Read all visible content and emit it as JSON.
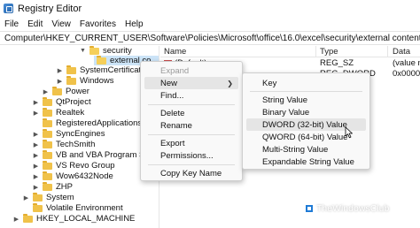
{
  "window": {
    "title": "Registry Editor"
  },
  "menubar": {
    "items": [
      "File",
      "Edit",
      "View",
      "Favorites",
      "Help"
    ]
  },
  "address": {
    "path": "Computer\\HKEY_CURRENT_USER\\Software\\Policies\\Microsoft\\office\\16.0\\excel\\security\\external content"
  },
  "tree": {
    "items": [
      {
        "label": "security",
        "chevron": "down",
        "selected": false
      },
      {
        "label": "external co...",
        "chevron": "",
        "selected": true
      },
      {
        "label": "SystemCertificates",
        "chevron": "right",
        "selected": false
      },
      {
        "label": "Windows",
        "chevron": "right",
        "selected": false
      },
      {
        "label": "Power",
        "chevron": "right",
        "selected": false
      },
      {
        "label": "QtProject",
        "chevron": "right",
        "selected": false
      },
      {
        "label": "Realtek",
        "chevron": "right",
        "selected": false
      },
      {
        "label": "RegisteredApplications",
        "chevron": "",
        "selected": false
      },
      {
        "label": "SyncEngines",
        "chevron": "right",
        "selected": false
      },
      {
        "label": "TechSmith",
        "chevron": "right",
        "selected": false
      },
      {
        "label": "VB and VBA Program Settin",
        "chevron": "right",
        "selected": false
      },
      {
        "label": "VS Revo Group",
        "chevron": "right",
        "selected": false
      },
      {
        "label": "Wow6432Node",
        "chevron": "right",
        "selected": false
      },
      {
        "label": "ZHP",
        "chevron": "right",
        "selected": false
      },
      {
        "label": "System",
        "chevron": "right",
        "selected": false
      },
      {
        "label": "Volatile Environment",
        "chevron": "",
        "selected": false
      },
      {
        "label": "HKEY_LOCAL_MACHINE",
        "chevron": "right",
        "selected": false
      }
    ]
  },
  "values_pane": {
    "headers": {
      "name": "Name",
      "type": "Type",
      "data": "Data"
    },
    "rows": [
      {
        "name": "(Default)",
        "type": "REG_SZ",
        "data": "(value no"
      },
      {
        "name": "",
        "type": "REG_DWORD",
        "data": "0x00000001"
      }
    ]
  },
  "context_menu": {
    "items": [
      {
        "label": "Expand",
        "disabled": true
      },
      {
        "label": "New",
        "disabled": false,
        "hover": true,
        "has_submenu": true
      },
      {
        "label": "Find...",
        "disabled": false
      },
      {
        "label": "Delete",
        "disabled": false
      },
      {
        "label": "Rename",
        "disabled": false
      },
      {
        "label": "Export",
        "disabled": false
      },
      {
        "label": "Permissions...",
        "disabled": false
      },
      {
        "label": "Copy Key Name",
        "disabled": false
      }
    ]
  },
  "submenu": {
    "items": [
      {
        "label": "Key"
      },
      {
        "label": "String Value"
      },
      {
        "label": "Binary Value"
      },
      {
        "label": "DWORD (32-bit) Value",
        "hover": true
      },
      {
        "label": "QWORD (64-bit) Value"
      },
      {
        "label": "Multi-String Value"
      },
      {
        "label": "Expandable String Value"
      }
    ]
  },
  "watermark": {
    "text": "TheWindowsClub"
  },
  "colors": {
    "selection": "#cce4f7",
    "folder": "#f0c24a",
    "menu_bg": "#f9f9f9",
    "hover": "#e5e5e5"
  },
  "icons": {
    "app": "registry-editor-icon",
    "folder": "folder-icon",
    "string_value": "string-value-icon",
    "cursor": "mouse-pointer-icon"
  }
}
